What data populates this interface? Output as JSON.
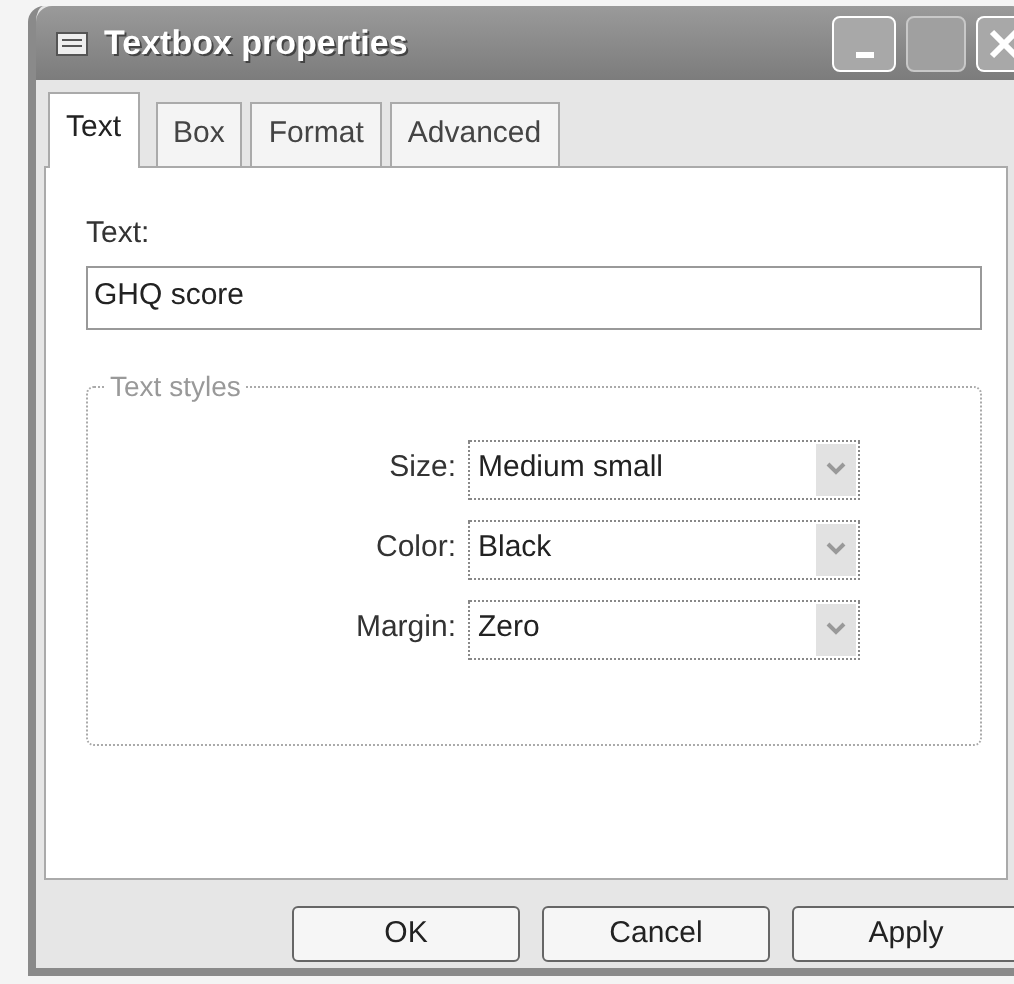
{
  "window": {
    "title": "Textbox properties"
  },
  "tabs": [
    {
      "label": "Text",
      "selected": true
    },
    {
      "label": "Box",
      "selected": false
    },
    {
      "label": "Format",
      "selected": false
    },
    {
      "label": "Advanced",
      "selected": false
    }
  ],
  "text_field": {
    "label": "Text:",
    "value": "GHQ score"
  },
  "text_styles": {
    "title": "Text styles",
    "fields": [
      {
        "label": "Size:",
        "value": "Medium small"
      },
      {
        "label": "Color:",
        "value": "Black"
      },
      {
        "label": "Margin:",
        "value": "Zero"
      }
    ]
  },
  "buttons": [
    "OK",
    "Cancel",
    "Apply"
  ]
}
